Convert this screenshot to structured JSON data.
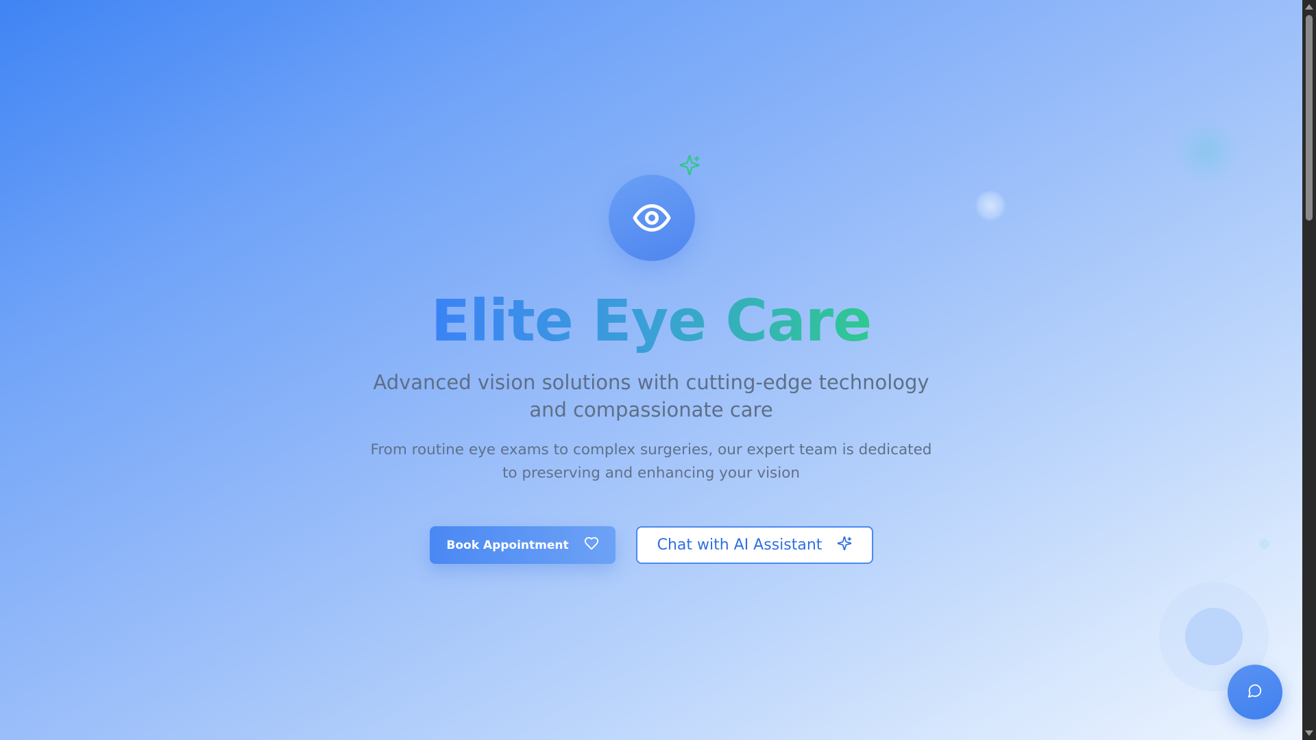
{
  "hero": {
    "icon": "eye-icon",
    "sparkle_icon": "sparkles-icon",
    "title": "Elite Eye Care",
    "subtitle": "Advanced vision solutions with cutting-edge technology and compassionate care",
    "description": "From routine eye exams to complex surgeries, our expert team is dedicated to preserving and enhancing your vision"
  },
  "actions": {
    "book": {
      "label": "Book Appointment",
      "icon": "heart-icon"
    },
    "chat": {
      "label": "Chat with AI Assistant",
      "icon": "sparkles-icon"
    }
  },
  "fab": {
    "icon": "chat-bubble-icon"
  },
  "colors": {
    "primary_blue": "#3b82f6",
    "accent_green": "#2ec98f",
    "sparkle_green": "#34c78a",
    "text_muted": "#5d6f86"
  }
}
